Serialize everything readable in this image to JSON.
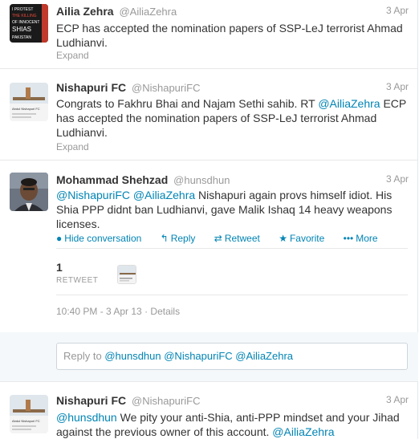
{
  "tweets": [
    {
      "name": "Ailia Zehra",
      "handle": "@AiliaZehra",
      "time": "3 Apr",
      "text": "ECP has accepted the nomination papers of SSP-LeJ terrorist Ahmad Ludhianvi.",
      "expand": "Expand",
      "avatar_text": "I PROTEST THE KILLING OF INNOCENT SHIAS IN PAKISTAN"
    },
    {
      "name": "Nishapuri FC",
      "handle": "@NishapuriFC",
      "time": "3 Apr",
      "text_pre": "Congrats to Fakhru Bhai and Najam Sethi sahib. RT ",
      "mention": "@AiliaZehra",
      "text_post": " ECP has accepted the nomination papers of SSP-LeJ terrorist Ahmad Ludhianvi.",
      "expand": "Expand",
      "avatar_text": "Abdul Nishapuri FC"
    }
  ],
  "main_tweet": {
    "name": "Mohammad Shehzad",
    "handle": "@hunsdhun",
    "time": "3 Apr",
    "mention1": "@NishapuriFC",
    "mention2": "@AiliaZehra",
    "text": " Nishapuri again provs himself idiot. His Shia PPP didnt ban Ludhianvi, gave Malik Ishaq 14 heavy weapons licenses.",
    "actions": {
      "hide": "Hide conversation",
      "reply": "Reply",
      "retweet": "Retweet",
      "favorite": "Favorite",
      "more": "More"
    },
    "retweet_count": "1",
    "retweet_label": "RETWEET",
    "timestamp": "10:40 PM - 3 Apr 13",
    "details_sep": " · ",
    "details": "Details"
  },
  "reply_box": {
    "prefix": "Reply to ",
    "recipients": "@hunsdhun @NishapuriFC @AiliaZehra"
  },
  "last_tweet": {
    "name": "Nishapuri FC",
    "handle": "@NishapuriFC",
    "time": "3 Apr",
    "mention": "@hunsdhun",
    "text": " We pity your anti-Shia, anti-PPP mindset and your Jihad against the previous owner of this account. ",
    "mention2": "@AiliaZehra"
  },
  "colors": {
    "link": "#0084b4",
    "meta": "#999999",
    "text": "#333333"
  }
}
